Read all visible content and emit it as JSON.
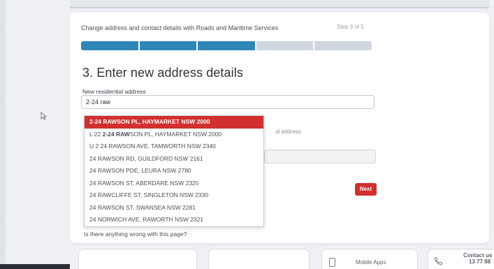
{
  "header": {
    "title": "Change address and contact details with Roads and Maritime Services",
    "step": "Step 3 of 5"
  },
  "progress": {
    "total_steps": 5,
    "completed_steps": 3
  },
  "form": {
    "heading": "3. Enter new address details",
    "address_label": "New residential address",
    "address_value": "2-24 raw",
    "postal_label_fragment": "al address",
    "next_label": "Next"
  },
  "suggestions": [
    {
      "bold": "2-24 RAW",
      "rest": "SON PL, HAYMARKET NSW 2000",
      "prefix": ""
    },
    {
      "prefix": "L 22 ",
      "bold": "2-24 RAW",
      "rest": "SON PL, HAYMARKET NSW 2000"
    },
    {
      "prefix": "",
      "bold": "",
      "rest": "U 2 24 RAWSON AVE, TAMWORTH NSW 2340"
    },
    {
      "prefix": "",
      "bold": "",
      "rest": "24 RAWSON RD, GUILDFORD NSW 2161"
    },
    {
      "prefix": "",
      "bold": "",
      "rest": "24 RAWSON PDE, LEURA NSW 2780"
    },
    {
      "prefix": "",
      "bold": "",
      "rest": "24 RAWSON ST, ABERDARE NSW 2325"
    },
    {
      "prefix": "",
      "bold": "",
      "rest": "24 RAWCLIFFE ST, SINGLETON NSW 2330"
    },
    {
      "prefix": "",
      "bold": "",
      "rest": "24 RAWSON ST, SWANSEA NSW 2281"
    },
    {
      "prefix": "",
      "bold": "",
      "rest": "24 NORWICH AVE, RAWORTH NSW 2321"
    }
  ],
  "help_link": "Is there anything wrong with this page?",
  "footer": {
    "mobile_apps": "Mobile Apps",
    "contact": "Contact us",
    "phone": "13 77 88"
  },
  "colors": {
    "accent_red": "#d22f2f",
    "progress_blue": "#2f86b8"
  }
}
